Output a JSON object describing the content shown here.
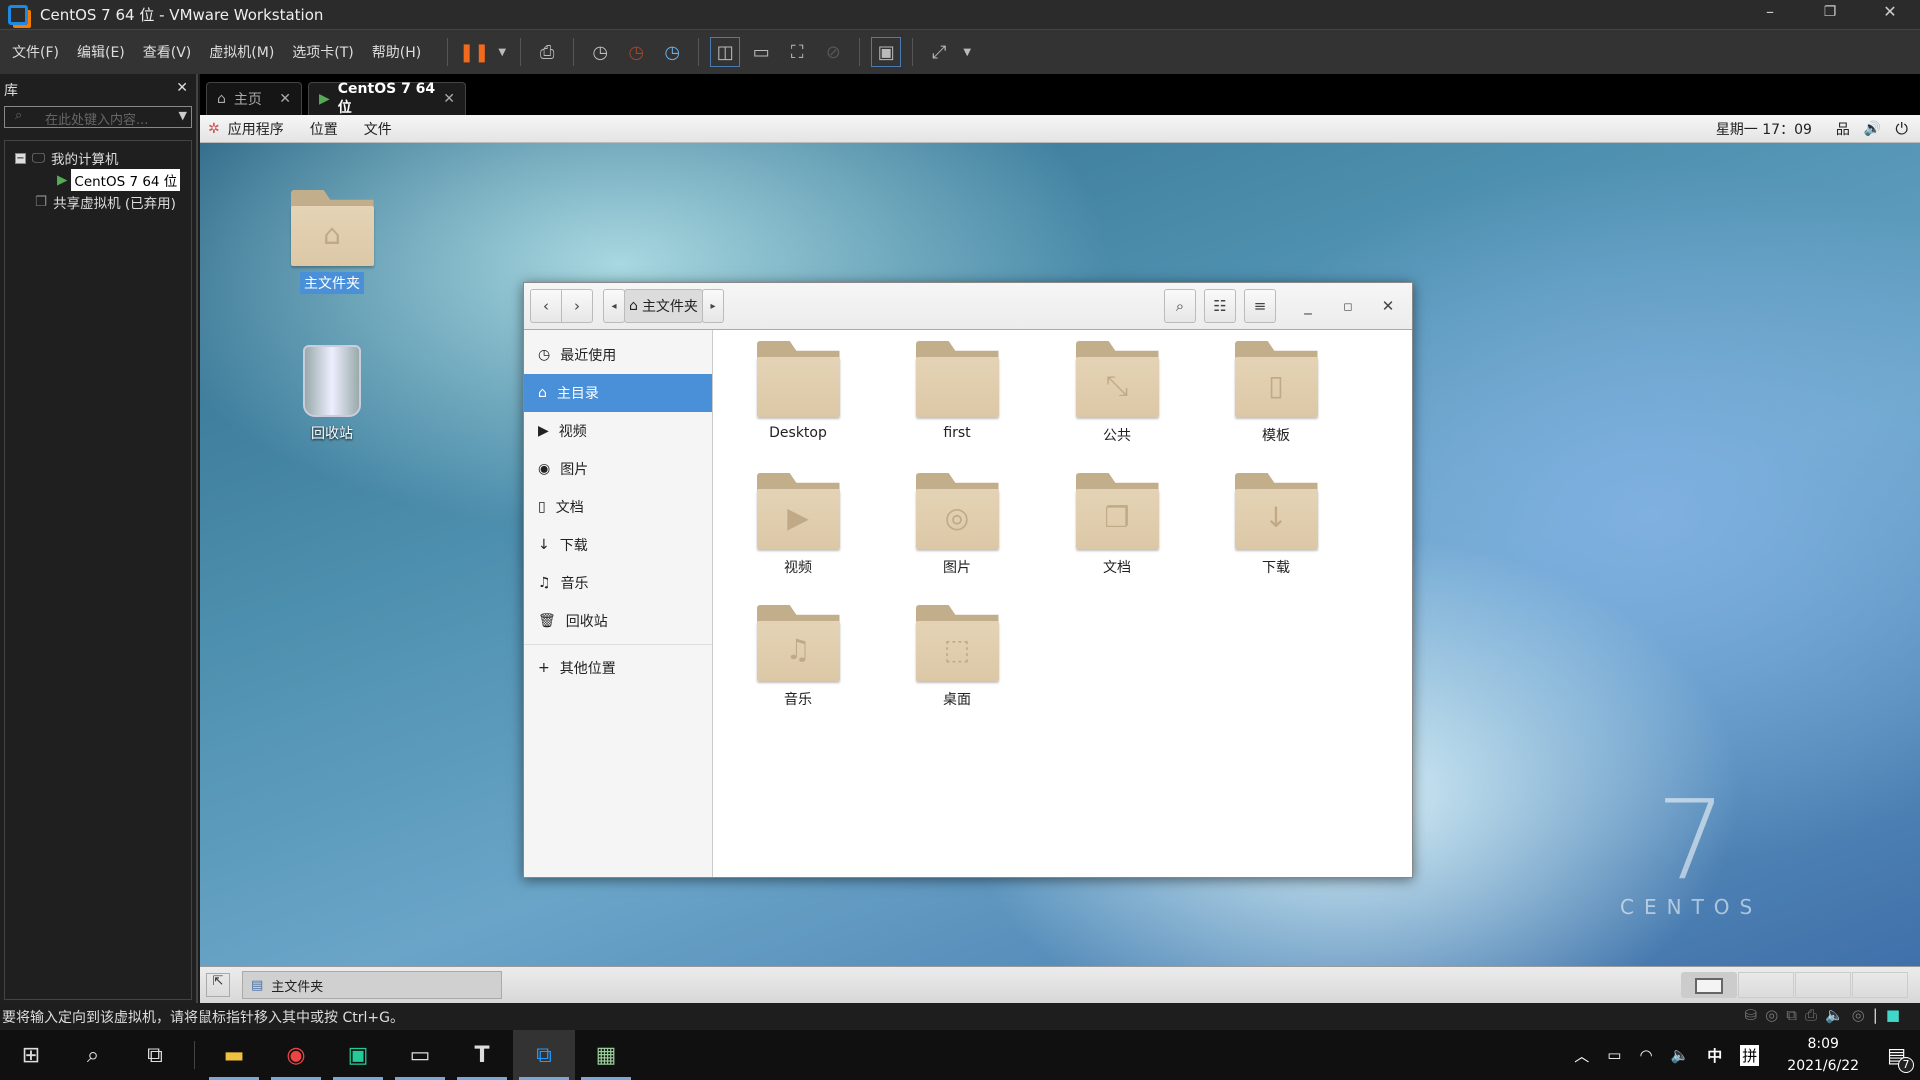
{
  "window": {
    "title": "CentOS 7 64 位 - VMware Workstation",
    "min": "–",
    "max": "❐",
    "close": "✕"
  },
  "menu": [
    "文件(F)",
    "编辑(E)",
    "查看(V)",
    "虚拟机(M)",
    "选项卡(T)",
    "帮助(H)"
  ],
  "library": {
    "title": "库",
    "close": "✕",
    "search_placeholder": "在此处键入内容...",
    "tree": {
      "root": "我的计算机",
      "vm": "CentOS 7 64 位",
      "shared": "共享虚拟机 (已弃用)"
    }
  },
  "tabs": [
    {
      "label": "主页",
      "close": "✕"
    },
    {
      "label": "CentOS 7 64 位",
      "close": "✕"
    }
  ],
  "guest": {
    "topbar": {
      "apps": "应用程序",
      "places": "位置",
      "files": "文件",
      "clock": "星期一 17：09"
    },
    "desktop": [
      {
        "label": "主文件夹",
        "icon": "home-folder-icon"
      },
      {
        "label": "回收站",
        "icon": "trash-icon"
      }
    ],
    "nautilus": {
      "path": "主文件夹",
      "sidebar": [
        {
          "label": "最近使用",
          "icon": "◷"
        },
        {
          "label": "主目录",
          "icon": "⌂",
          "selected": true
        },
        {
          "label": "视频",
          "icon": "▶"
        },
        {
          "label": "图片",
          "icon": "◉"
        },
        {
          "label": "文档",
          "icon": "▯"
        },
        {
          "label": "下载",
          "icon": "↓"
        },
        {
          "label": "音乐",
          "icon": "♫"
        },
        {
          "label": "回收站",
          "icon": "🗑"
        },
        {
          "label": "其他位置",
          "icon": "+"
        }
      ],
      "items": [
        {
          "label": "Desktop",
          "glyph": ""
        },
        {
          "label": "first",
          "glyph": ""
        },
        {
          "label": "公共",
          "glyph": "⤡"
        },
        {
          "label": "模板",
          "glyph": "▯"
        },
        {
          "label": "视频",
          "glyph": "▶"
        },
        {
          "label": "图片",
          "glyph": "◎"
        },
        {
          "label": "文档",
          "glyph": "❐"
        },
        {
          "label": "下载",
          "glyph": "↓"
        },
        {
          "label": "音乐",
          "glyph": "♫"
        },
        {
          "label": "桌面",
          "glyph": "⬚"
        }
      ]
    },
    "taskbar": {
      "window": "主文件夹"
    },
    "brand": {
      "number": "7",
      "name": "CENTOS"
    }
  },
  "status": "要将输入定向到该虚拟机，请将鼠标指针移入其中或按 Ctrl+G。",
  "taskbar": {
    "time": "8:09",
    "date": "2021/6/22",
    "ime1": "中",
    "ime2": "拼",
    "notifications": "7"
  }
}
